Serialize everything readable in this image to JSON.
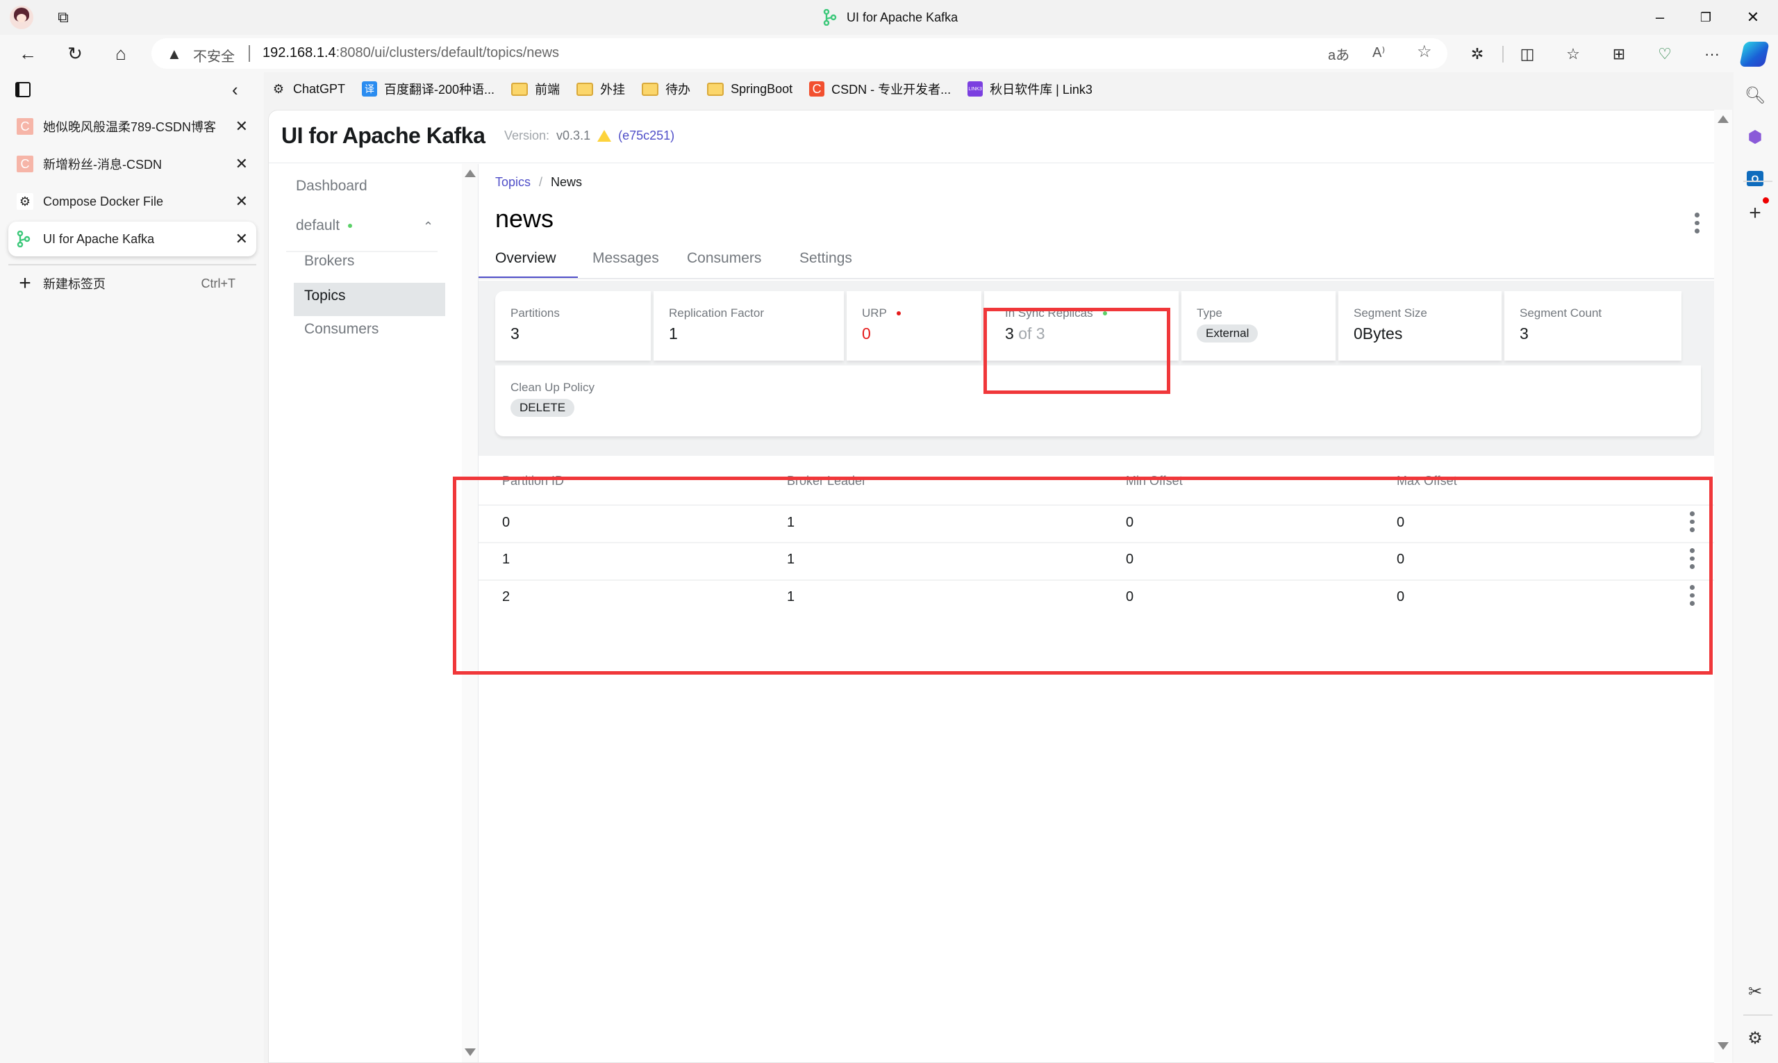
{
  "browser": {
    "window_title": "UI for Apache Kafka",
    "address": {
      "security_label": "不安全",
      "url_host": "192.168.1.4",
      "url_rest": ":8080/ui/clusters/default/topics/news"
    },
    "bookmarks": [
      {
        "label": "ChatGPT",
        "icon": "chatgpt-icon"
      },
      {
        "label": "百度翻译-200种语...",
        "icon": "baidu-translate-icon"
      },
      {
        "label": "前端",
        "icon": "folder-icon"
      },
      {
        "label": "外挂",
        "icon": "folder-icon"
      },
      {
        "label": "待办",
        "icon": "folder-icon"
      },
      {
        "label": "SpringBoot",
        "icon": "folder-icon"
      },
      {
        "label": "CSDN - 专业开发者...",
        "icon": "csdn-icon"
      },
      {
        "label": "秋日软件库 | Link3",
        "icon": "link3-icon"
      }
    ],
    "vertical_tabs": [
      {
        "label": "她似晚风般温柔789-CSDN博客",
        "icon": "csdn-icon",
        "active": false
      },
      {
        "label": "新增粉丝-消息-CSDN",
        "icon": "csdn-icon",
        "active": false
      },
      {
        "label": "Compose Docker File",
        "icon": "chatgpt-icon",
        "active": false
      },
      {
        "label": "UI for Apache Kafka",
        "icon": "kafka-icon",
        "active": true
      }
    ],
    "new_tab": {
      "label": "新建标签页",
      "shortcut": "Ctrl+T"
    },
    "translate_glyph": "aあ",
    "read_aloud_glyph": "A",
    "more_glyph": "···"
  },
  "app": {
    "brand": "UI for Apache Kafka",
    "version_label": "Version:",
    "version": "v0.3.1",
    "commit": "(e75c251)",
    "nav": {
      "dashboard": "Dashboard",
      "cluster": "default",
      "cluster_status_color": "#5bd068",
      "brokers": "Brokers",
      "topics": "Topics",
      "consumers": "Consumers"
    },
    "breadcrumb": {
      "parent": "Topics",
      "separator": "/",
      "current": "News"
    },
    "topic_name": "news",
    "tabs": [
      "Overview",
      "Messages",
      "Consumers",
      "Settings"
    ],
    "active_tab": "Overview",
    "metrics": [
      {
        "label": "Partitions",
        "value": "3"
      },
      {
        "label": "Replication Factor",
        "value": "1"
      },
      {
        "label": "URP",
        "value": "0",
        "indicator_color": "#e51a1a"
      },
      {
        "label": "In Sync Replicas",
        "value": "3",
        "value_suffix": "of 3",
        "indicator_color": "#5bd068"
      },
      {
        "label": "Type",
        "value": "External"
      },
      {
        "label": "Segment Size",
        "value": "0Bytes"
      },
      {
        "label": "Segment Count",
        "value": "3"
      }
    ],
    "cleanup_policy": {
      "label": "Clean Up Policy",
      "value": "DELETE"
    },
    "partitions_table": {
      "columns": [
        "Partition ID",
        "Broker Leader",
        "Min Offset",
        "Max Offset"
      ],
      "rows": [
        [
          "0",
          "1",
          "0",
          "0"
        ],
        [
          "1",
          "1",
          "0",
          "0"
        ],
        [
          "2",
          "1",
          "0",
          "0"
        ]
      ]
    }
  },
  "annotations": {
    "highlight_color": "#f0373a"
  }
}
